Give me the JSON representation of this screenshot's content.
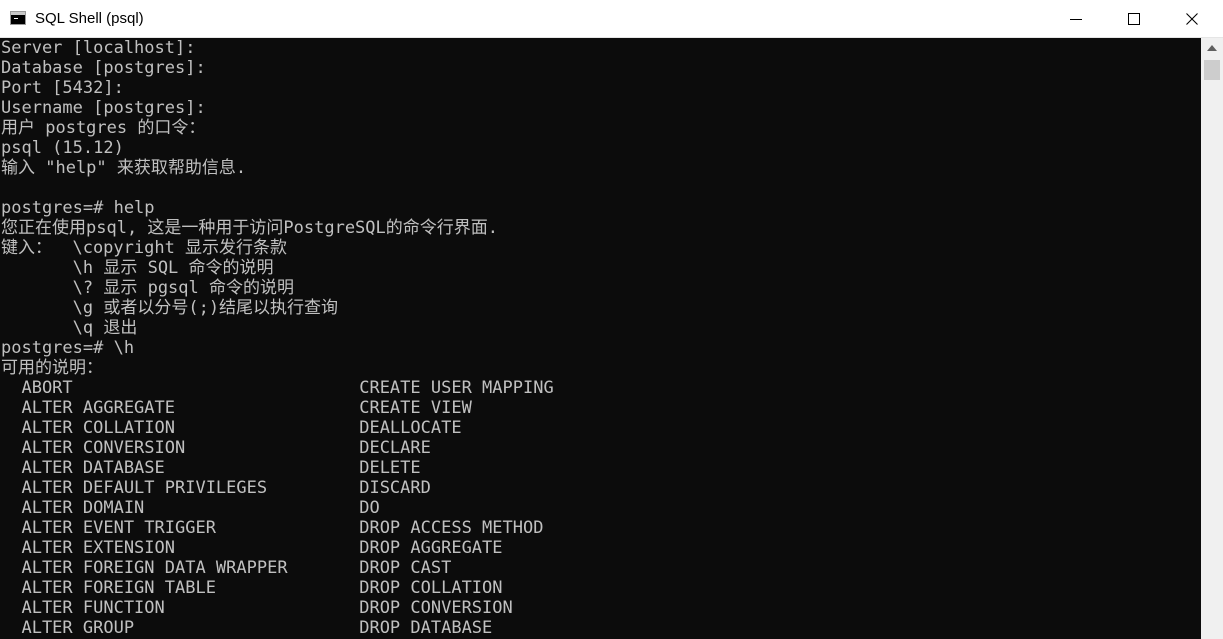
{
  "window": {
    "title": "SQL Shell (psql)"
  },
  "console": {
    "lines": [
      "Server [localhost]:",
      "Database [postgres]:",
      "Port [5432]:",
      "Username [postgres]:",
      "用户 postgres 的口令：",
      "psql (15.12)",
      "输入 \"help\" 来获取帮助信息.",
      "",
      "postgres=# help",
      "您正在使用psql, 这是一种用于访问PostgreSQL的命令行界面.",
      "键入：  \\copyright 显示发行条款",
      "       \\h 显示 SQL 命令的说明",
      "       \\? 显示 pgsql 命令的说明",
      "       \\g 或者以分号(;)结尾以执行查询",
      "       \\q 退出",
      "postgres=# \\h",
      "可用的说明：",
      "  ABORT                            CREATE USER MAPPING",
      "  ALTER AGGREGATE                  CREATE VIEW",
      "  ALTER COLLATION                  DEALLOCATE",
      "  ALTER CONVERSION                 DECLARE",
      "  ALTER DATABASE                   DELETE",
      "  ALTER DEFAULT PRIVILEGES         DISCARD",
      "  ALTER DOMAIN                     DO",
      "  ALTER EVENT TRIGGER              DROP ACCESS METHOD",
      "  ALTER EXTENSION                  DROP AGGREGATE",
      "  ALTER FOREIGN DATA WRAPPER       DROP CAST",
      "  ALTER FOREIGN TABLE              DROP COLLATION",
      "  ALTER FUNCTION                   DROP CONVERSION",
      "  ALTER GROUP                      DROP DATABASE"
    ]
  },
  "icons": {
    "app": "console-icon",
    "minimize": "minimize-icon",
    "maximize": "maximize-icon",
    "close": "close-icon",
    "scroll_up": "chevron-up-icon"
  },
  "colors": {
    "console_bg": "#0c0c0c",
    "console_text": "#c0c0c0",
    "titlebar_bg": "#ffffff",
    "scrollbar_bg": "#f0f0f0",
    "scroll_thumb": "#cdcdcd"
  }
}
